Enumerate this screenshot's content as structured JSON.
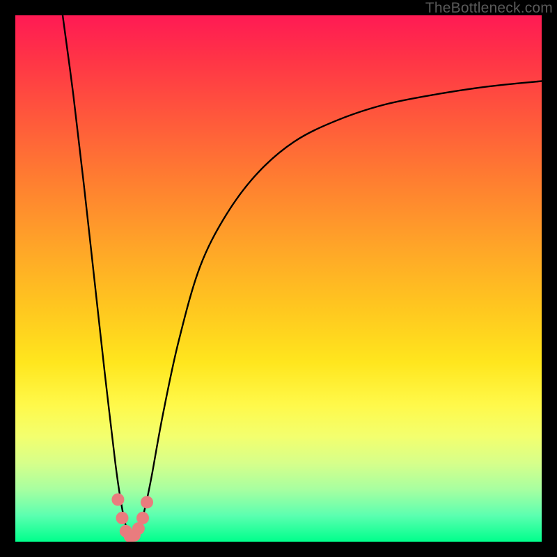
{
  "watermark": "TheBottleneck.com",
  "chart_data": {
    "type": "line",
    "title": "",
    "xlabel": "",
    "ylabel": "",
    "xlim": [
      0,
      100
    ],
    "ylim": [
      0,
      100
    ],
    "grid": false,
    "legend": false,
    "notes": "V-shaped bottleneck curve: y is distance-from-optimal (100 = worst, 0 = perfect). Minimum near x≈22. Background vertical gradient encodes y: red (top/bad) → yellow (mid) → green (bottom/good). Pink dot markers cluster in the trough.",
    "series": [
      {
        "name": "bottleneck-curve",
        "x": [
          9,
          11,
          13,
          15,
          17,
          19,
          20,
          21,
          22,
          23,
          24,
          25,
          26,
          28,
          31,
          35,
          40,
          46,
          53,
          61,
          70,
          80,
          90,
          100
        ],
        "y": [
          100,
          85,
          68,
          50,
          32,
          15,
          8,
          3,
          1,
          2,
          4,
          8,
          13,
          24,
          38,
          52,
          62,
          70,
          76,
          80,
          83,
          85,
          86.5,
          87.5
        ]
      }
    ],
    "markers": {
      "name": "trough-dots",
      "color": "#e97c7e",
      "x": [
        19.5,
        20.3,
        21.0,
        21.8,
        22.6,
        23.4,
        24.2,
        25.0
      ],
      "y": [
        8.0,
        4.5,
        2.0,
        1.0,
        1.2,
        2.5,
        4.5,
        7.5
      ]
    },
    "gradient_stops": [
      {
        "pos": 0.0,
        "color": "#ff1a54"
      },
      {
        "pos": 0.2,
        "color": "#ff5a3b"
      },
      {
        "pos": 0.44,
        "color": "#ffa528"
      },
      {
        "pos": 0.66,
        "color": "#ffe61e"
      },
      {
        "pos": 0.8,
        "color": "#f3ff6e"
      },
      {
        "pos": 0.9,
        "color": "#a8ffa0"
      },
      {
        "pos": 1.0,
        "color": "#00ff8c"
      }
    ]
  }
}
